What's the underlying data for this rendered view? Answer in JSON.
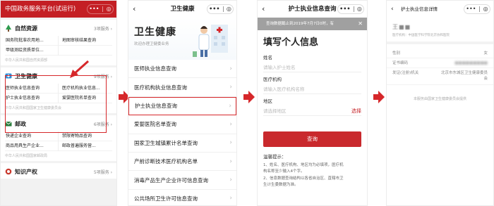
{
  "phone1": {
    "title": "中国政务服务平台(试运行)",
    "capsule": [
      "•••",
      "◎"
    ],
    "cards": [
      {
        "icon": "tree-icon",
        "title": "自然资源",
        "count": "3项服务 ›",
        "items": [
          "国务院批准农用地...",
          "地图审核结果查询",
          "甲级测绘资质单位..."
        ],
        "source": "中华人民共和国自然资源部"
      },
      {
        "icon": "health-icon",
        "title": "卫生健康",
        "count": "9项服务 ›",
        "items": [
          "医师执业信息查询",
          "医疗机构执业信息...",
          "护士执业信息查询",
          "爱婴医院名单查询"
        ],
        "source": "中华人民共和国国家卫生健康委员会"
      },
      {
        "icon": "mail-icon",
        "title": "邮政",
        "count": "6项服务 ›",
        "items": [
          "快递企业查询",
          "禁限寄物品查询",
          "商品用具生产企业...",
          "邮政普遍服务营..."
        ],
        "source": "中华人民共和国国家邮政局"
      },
      {
        "icon": "patent-icon",
        "title": "知识产权",
        "count": "5项服务 ›",
        "items": [],
        "source": ""
      }
    ]
  },
  "phone2": {
    "title": "卫生健康",
    "back": "‹",
    "capsule": [
      "•••",
      "◎"
    ],
    "banner_title": "卫生健康",
    "banner_sub": "欢迎办理卫健委业务",
    "items": [
      "医师执业信息查询",
      "医疗机构执业信息查询",
      "护士执业信息查询",
      "爱婴医院名单查询",
      "国家卫生城镇累计名单查询",
      "产前诊断技术医疗机构名单",
      "消毒产品生产企业许可信息查询",
      "公共场所卫生许可信息查询"
    ],
    "selected_index": 2,
    "chevron": "›"
  },
  "phone3": {
    "title": "护士执业信息查询",
    "back": "‹",
    "capsule": [
      "•••",
      "◎"
    ],
    "notice": "查询数据截止到2019年7月7日0时，有",
    "notice_close": "✕",
    "heading": "填写个人信息",
    "fields": [
      {
        "label": "姓名",
        "placeholder": "请输入护士姓名",
        "action": ""
      },
      {
        "label": "医疗机构",
        "placeholder": "请输入医疗机构名称",
        "action": ""
      },
      {
        "label": "地区",
        "placeholder": "请选择地区",
        "action": "选择"
      }
    ],
    "button": "查询",
    "tips_title": "温馨提示：",
    "tips": [
      "1、姓名、医疗机构、地区均为必填项，医疗机",
      "构名称至少输入4个字。",
      "2、信息数据查询结构以各省自治区、直辖市卫",
      "生计生委数据为准。"
    ]
  },
  "phone4": {
    "title": "护士执业信息详情",
    "back": "‹",
    "capsule": [
      "•••",
      "◎"
    ],
    "name": "王■■",
    "org": "医疗机构：中国医学科学院北京协和医院",
    "rows": [
      {
        "k": "性别",
        "v": "女",
        "blur": false
      },
      {
        "k": "证书编码",
        "v": "■■■■■■■■■",
        "blur": true
      },
      {
        "k": "发证(注册)机关",
        "v": "北京市东城区卫生健康委员会",
        "blur": false
      }
    ],
    "footer": "本服务由国家卫生健康委员会提供"
  }
}
